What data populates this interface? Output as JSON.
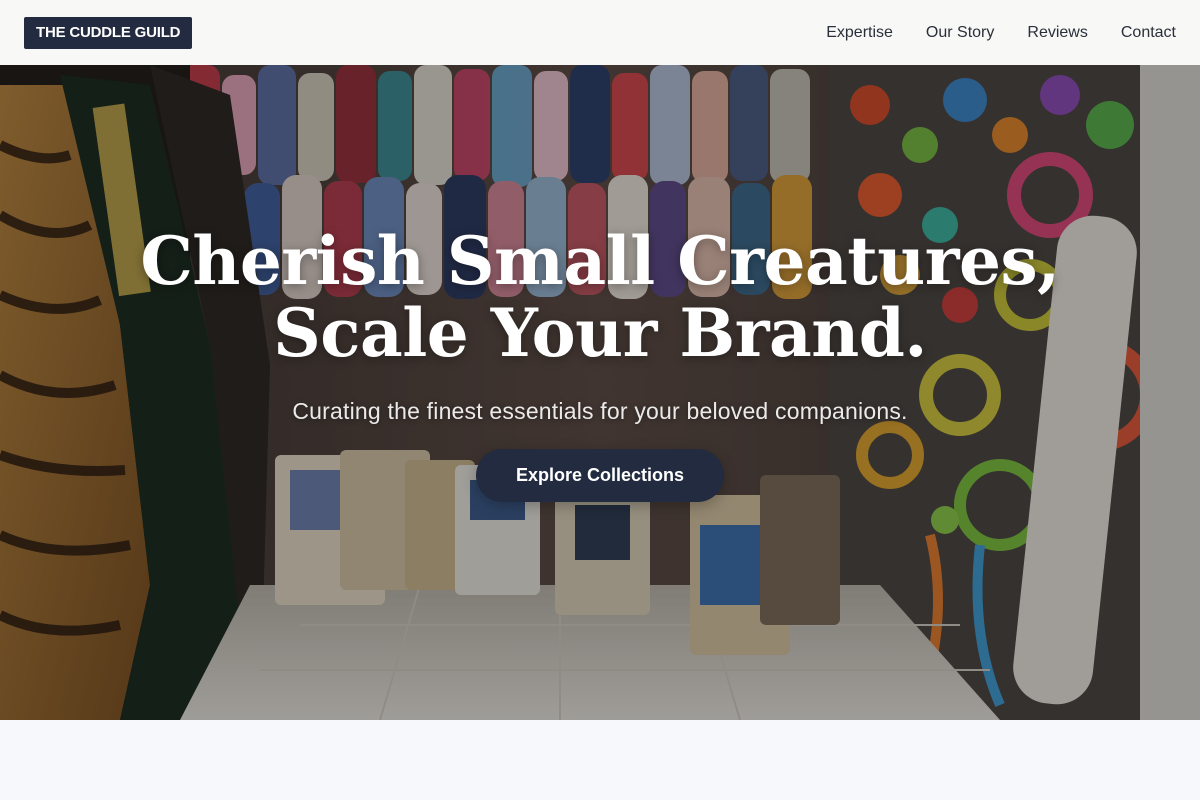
{
  "brand": {
    "name": "THE CUDDLE GUILD"
  },
  "nav": {
    "items": [
      {
        "label": "Expertise"
      },
      {
        "label": "Our Story"
      },
      {
        "label": "Reviews"
      },
      {
        "label": "Contact"
      }
    ]
  },
  "hero": {
    "title_line1": "Cherish Small Creatures,",
    "title_line2": "Scale Your Brand.",
    "subtitle": "Curating the finest essentials for your beloved companions.",
    "cta_label": "Explore Collections"
  },
  "colors": {
    "brand_navy": "#222b3f",
    "header_bg": "#f7f7f5",
    "page_bg": "#f7f8fc",
    "hero_text": "#ffffff"
  }
}
